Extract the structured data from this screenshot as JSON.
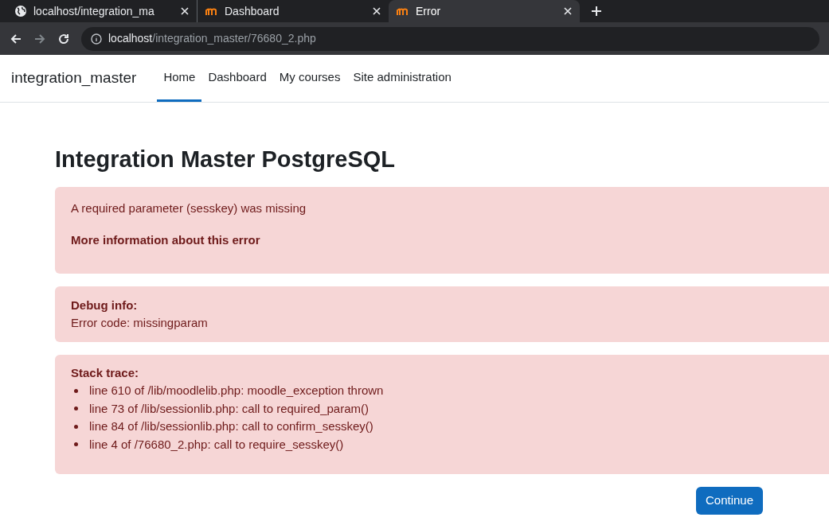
{
  "browser": {
    "tabs": [
      {
        "title": "localhost/integration_ma",
        "kind": "globe",
        "selected": false
      },
      {
        "title": "Dashboard",
        "kind": "moodle",
        "selected": false
      },
      {
        "title": "Error",
        "kind": "moodle",
        "selected": true
      }
    ],
    "address": {
      "host": "localhost",
      "path": "/integration_master/76680_2.php"
    }
  },
  "navbar": {
    "brand": "integration_master",
    "items": [
      {
        "label": "Home",
        "selected": true
      },
      {
        "label": "Dashboard",
        "selected": false
      },
      {
        "label": "My courses",
        "selected": false
      },
      {
        "label": "Site administration",
        "selected": false
      }
    ]
  },
  "page": {
    "heading": "Integration Master PostgreSQL",
    "error": {
      "message": "A required parameter (sesskey) was missing",
      "more_info": "More information about this error"
    },
    "debug": {
      "title": "Debug info:",
      "text": "Error code: missingparam"
    },
    "stack": {
      "title": "Stack trace:",
      "lines": [
        "line 610 of /lib/moodlelib.php: moodle_exception thrown",
        "line 73 of /lib/sessionlib.php: call to required_param()",
        "line 84 of /lib/sessionlib.php: call to confirm_sesskey()",
        "line 4 of /76680_2.php: call to require_sesskey()"
      ]
    },
    "button": "Continue"
  }
}
